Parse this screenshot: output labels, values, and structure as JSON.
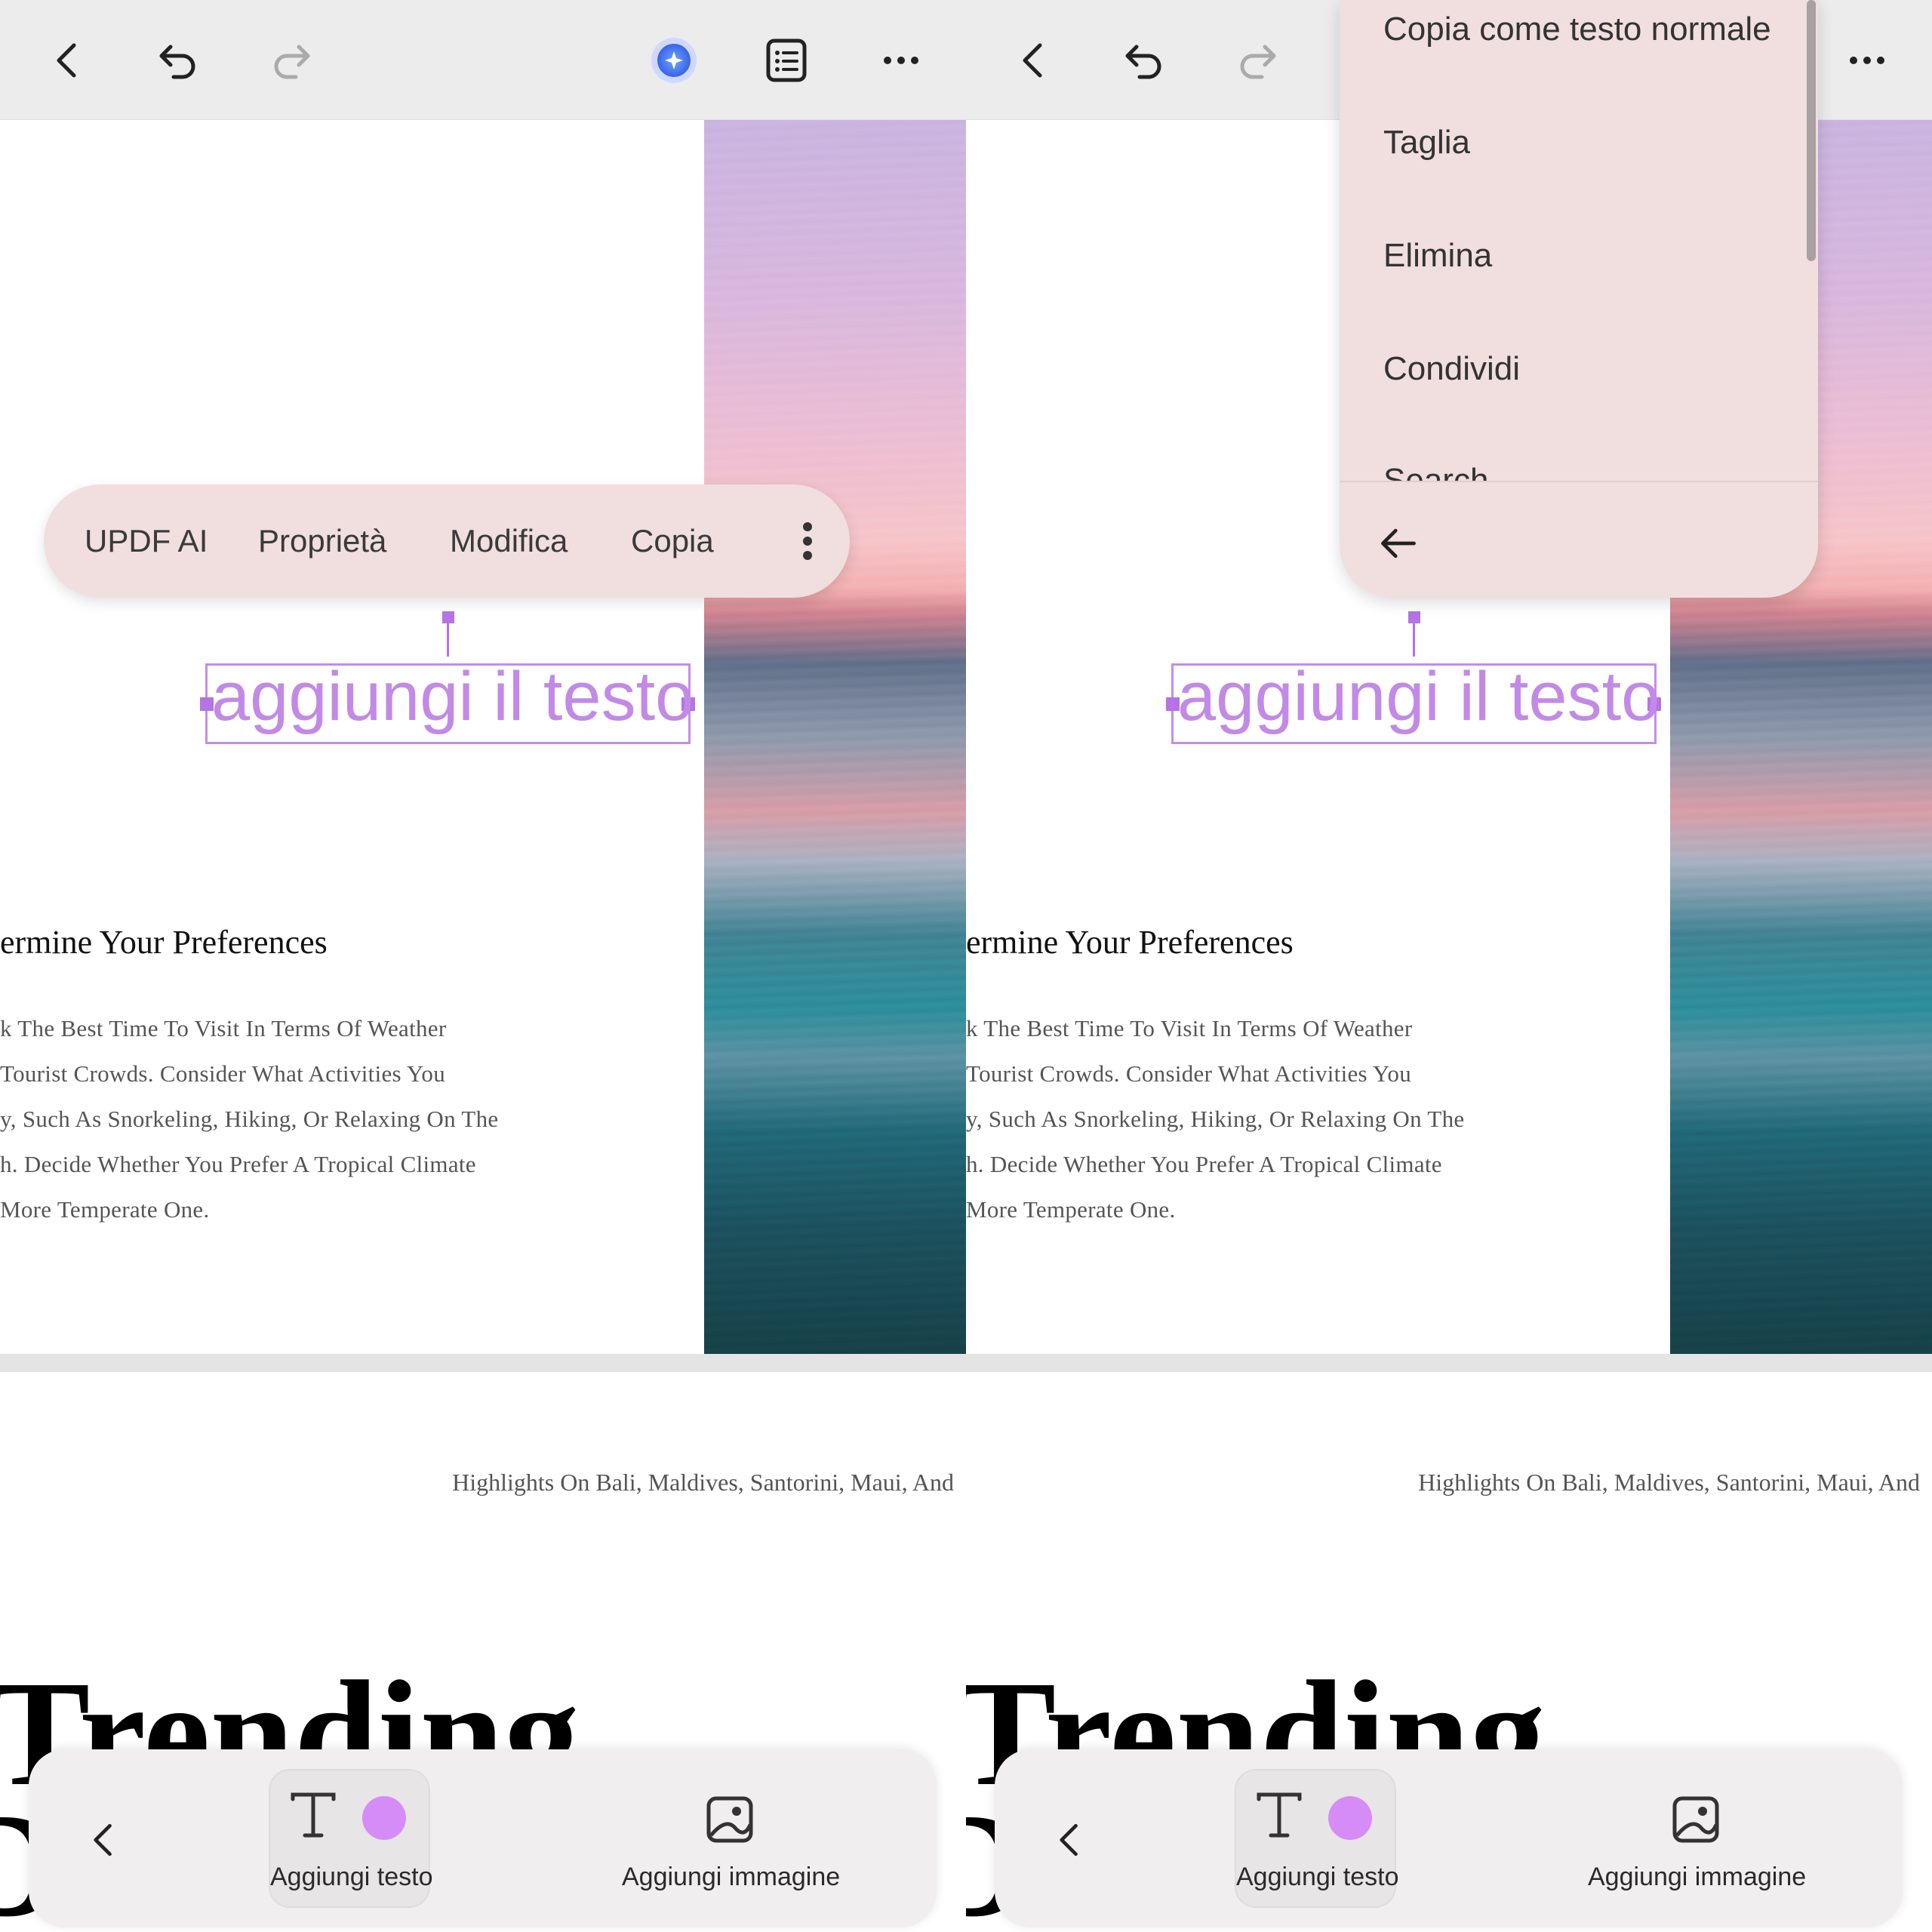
{
  "toolbar": {
    "back_icon": "chevron-left-icon",
    "undo_icon": "undo-icon",
    "redo_icon": "redo-icon",
    "ai_icon": "updf-ai-icon",
    "outline_icon": "list-icon",
    "more_icon": "more-horizontal-icon"
  },
  "document": {
    "added_text": "aggiungi il testo",
    "heading": "ermine Your Preferences",
    "body_lines": [
      "k The Best Time To Visit In Terms Of Weather",
      "Tourist Crowds. Consider What Activities You",
      "y, Such As Snorkeling, Hiking, Or Relaxing On The",
      "h. Decide Whether You Prefer A Tropical Climate",
      " More Temperate One."
    ],
    "page2_line": "Highlights On Bali, Maldives, Santorini, Maui, And",
    "page2_title": "Trending",
    "page2_title_line2": "D"
  },
  "context_menu": {
    "items": [
      "UPDF AI",
      "Proprietà",
      "Modifica",
      "Copia"
    ],
    "more_icon": "more-vertical-icon"
  },
  "overflow_menu": {
    "items": [
      "Copia come testo normale",
      "Taglia",
      "Elimina",
      "Condividi",
      "Search"
    ],
    "back_icon": "arrow-left-icon"
  },
  "bottom_toolbar": {
    "back_icon": "chevron-left-icon",
    "add_text_label": "Aggiungi testo",
    "add_image_label": "Aggiungi immagine",
    "text_color": "#d68cf7"
  },
  "colors": {
    "selection": "#b573e6",
    "added_text": "#c28ae6",
    "menu_bg": "#f1dedf"
  }
}
